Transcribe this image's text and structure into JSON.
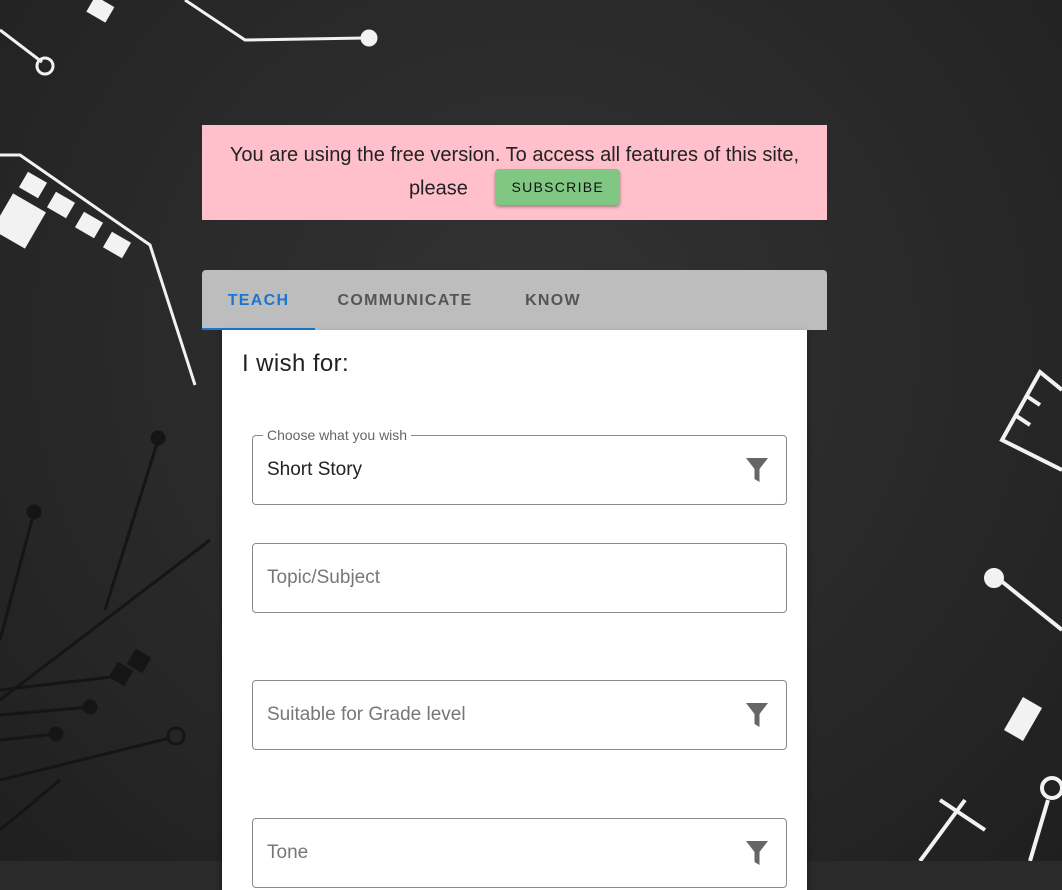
{
  "banner": {
    "text": "You are using the free version. To access all features of this site, please",
    "subscribe_label": "SUBSCRIBE"
  },
  "tabs": [
    {
      "label": "TEACH",
      "active": true
    },
    {
      "label": "COMMUNICATE",
      "active": false
    },
    {
      "label": "KNOW",
      "active": false
    }
  ],
  "form": {
    "title": "I wish for:",
    "wish_select": {
      "label": "Choose what you wish",
      "value": "Short Story",
      "icon": "filter-icon"
    },
    "topic_input": {
      "placeholder": "Topic/Subject",
      "value": ""
    },
    "grade_select": {
      "placeholder": "Suitable for Grade level",
      "icon": "filter-icon"
    },
    "tone_select": {
      "placeholder": "Tone",
      "icon": "filter-icon"
    }
  },
  "colors": {
    "banner_bg": "#ffc0cb",
    "subscribe_bg": "#81c784",
    "tab_bar_bg": "#bdbdbd",
    "active_tab": "#1976d2",
    "background": "#2a2a2a"
  }
}
